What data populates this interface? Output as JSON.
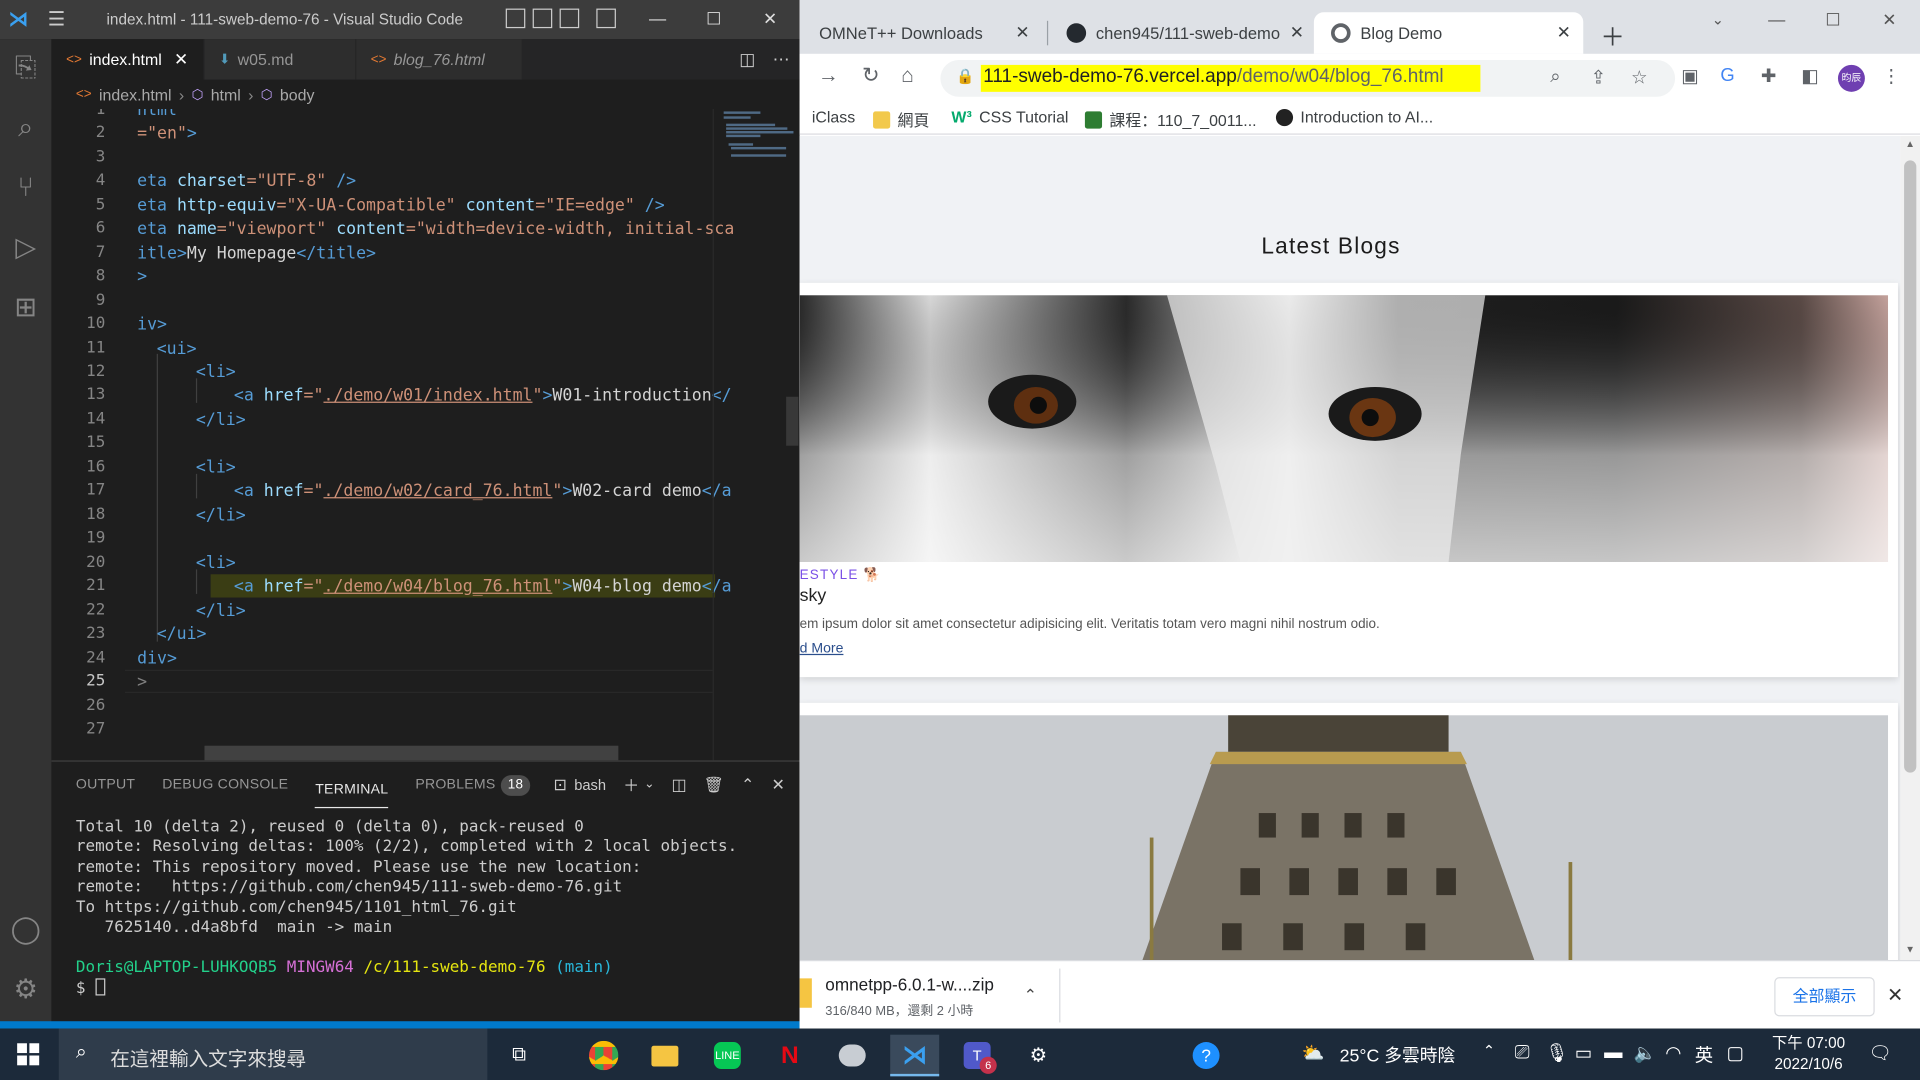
{
  "vscode": {
    "title": "index.html - 111-sweb-demo-76 - Visual Studio Code",
    "tabs": [
      {
        "label": "index.html",
        "active": true,
        "icon": "html-icon"
      },
      {
        "label": "w05.md",
        "active": false,
        "icon": "markdown-icon"
      },
      {
        "label": "blog_76.html",
        "active": false,
        "icon": "html-icon",
        "italic": true
      }
    ],
    "breadcrumb": [
      "index.html",
      "html",
      "body"
    ],
    "line_numbers": [
      "1",
      "2",
      "3",
      "4",
      "5",
      "6",
      "7",
      "8",
      "9",
      "10",
      "11",
      "12",
      "13",
      "14",
      "15",
      "16",
      "17",
      "18",
      "19",
      "20",
      "21",
      "22",
      "23",
      "24",
      "25",
      "26",
      "27"
    ],
    "code": {
      "l1": "html",
      "l2_attr": "=\"en\"",
      "l2_close": ">",
      "l4_a": "eta ",
      "l4_b": "charset",
      "l4_c": "=\"UTF-8\"",
      "l4_d": " />",
      "l5_a": "eta ",
      "l5_b": "http-equiv",
      "l5_c": "=\"X-UA-Compatible\"",
      "l5_d": " content",
      "l5_e": "=\"IE=edge\"",
      "l5_f": " />",
      "l6_a": "eta ",
      "l6_b": "name",
      "l6_c": "=\"viewport\"",
      "l6_d": " content",
      "l6_e": "=\"width=device-width, initial-sca",
      "l7_a": "itle>",
      "l7_b": "My Homepage",
      "l7_c": "</title>",
      "l8": ">",
      "l10": "iv>",
      "l11": "<ui>",
      "li_open": "<li>",
      "li_close": "</li>",
      "a_open": "<a ",
      "href": "href",
      "eq": "=\"",
      "q_close": "\"",
      "gt": ">",
      "a_close": "</",
      "a_close2": "</a",
      "l13_href": "./demo/w01/index.html",
      "l13_text": "W01-introduction",
      "l17_href": "./demo/w02/card_76.html",
      "l17_text": "W02-card demo",
      "l21_href": "./demo/w04/blog_76.html",
      "l21_text": "W04-blog demo",
      "l23": "</ui>",
      "l24": "div>",
      "l25": ">"
    },
    "panel": {
      "tabs": [
        "OUTPUT",
        "DEBUG CONSOLE",
        "TERMINAL",
        "PROBLEMS"
      ],
      "problems_count": "18",
      "shell": "bash"
    },
    "terminal": {
      "lines": [
        "Total 10 (delta 2), reused 0 (delta 0), pack-reused 0",
        "remote: Resolving deltas: 100% (2/2), completed with 2 local objects.",
        "remote: This repository moved. Please use the new location:",
        "remote:   https://github.com/chen945/111-sweb-demo-76.git",
        "To https://github.com/chen945/1101_html_76.git",
        "   7625140..d4a8bfd  main -> main"
      ],
      "prompt_user": "Doris@LAPTOP-LUHKOQB5",
      "prompt_env": "MINGW64",
      "prompt_path": "/c/111-sweb-demo-76",
      "prompt_branch": "(main)",
      "prompt_symbol": "$"
    }
  },
  "chrome": {
    "tabs": [
      {
        "label": "OMNeT++ Downloads"
      },
      {
        "label": "chen945/111-sweb-demo"
      },
      {
        "label": "Blog Demo",
        "active": true
      }
    ],
    "url_host": "111-sweb-demo-76.vercel.app",
    "url_path": "/demo/w04/blog_76.html",
    "avatar_text": "昀辰",
    "bookmarks": [
      "iClass",
      "網頁",
      "CSS Tutorial",
      "課程：110_7_0011...",
      "Introduction to AI..."
    ],
    "page": {
      "heading": "Latest Blogs",
      "cards": [
        {
          "category": "ESTYLE",
          "title": "sky",
          "desc": "em ipsum dolor sit amet consectetur adipisicing elit. Veritatis totam vero magni nihil nostrum odio.",
          "link": "d More"
        }
      ]
    },
    "download": {
      "filename": "omnetpp-6.0.1-w....zip",
      "status": "316/840 MB，還剩 2 小時",
      "show_all": "全部顯示"
    }
  },
  "taskbar": {
    "search_placeholder": "在這裡輸入文字來搜尋",
    "weather": "25°C  多雲時陰",
    "ime": "英",
    "time": "下午 07:00",
    "date": "2022/10/6",
    "teams_badge": "6"
  },
  "colors": {
    "vscode_bg": "#1e1e1e",
    "accent_blue": "#007acc",
    "url_highlight": "#ffff00",
    "category_purple": "#7a50e6"
  }
}
